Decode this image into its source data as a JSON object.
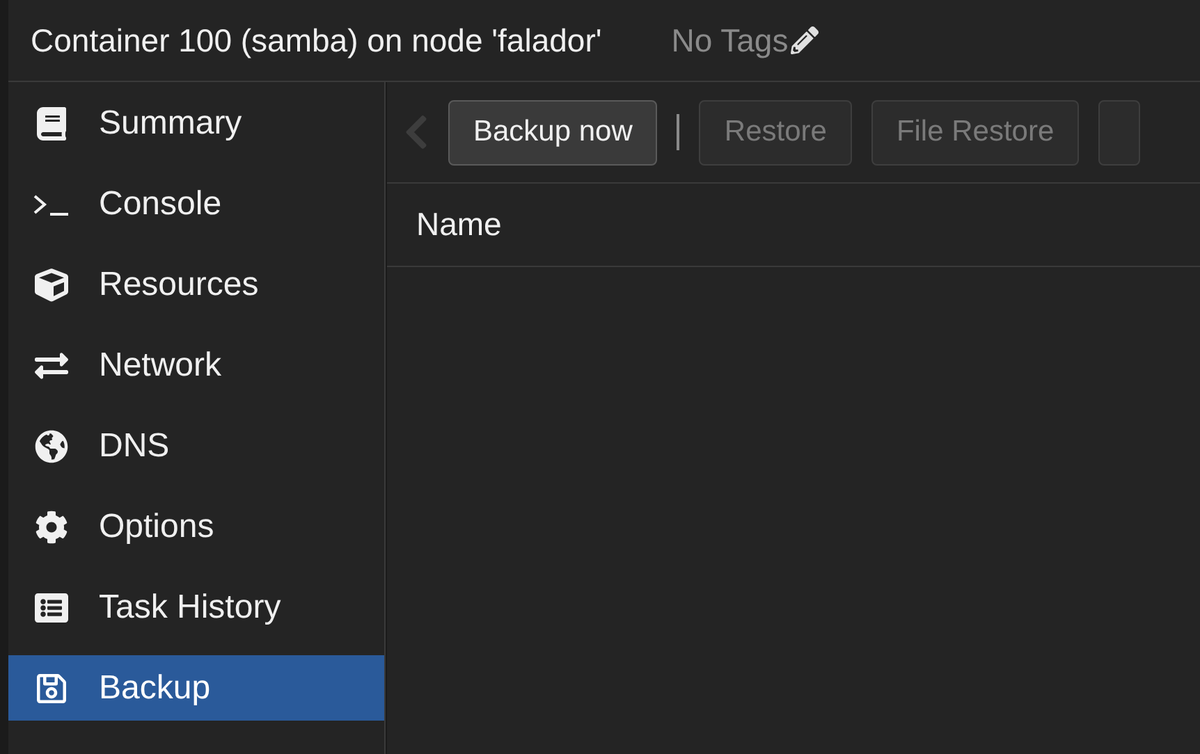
{
  "header": {
    "title": "Container 100 (samba) on node 'falador'",
    "tags": "No Tags"
  },
  "sidebar": {
    "items": [
      {
        "label": "Summary",
        "selected": false
      },
      {
        "label": "Console",
        "selected": false
      },
      {
        "label": "Resources",
        "selected": false
      },
      {
        "label": "Network",
        "selected": false
      },
      {
        "label": "DNS",
        "selected": false
      },
      {
        "label": "Options",
        "selected": false
      },
      {
        "label": "Task History",
        "selected": false
      },
      {
        "label": "Backup",
        "selected": true
      }
    ]
  },
  "toolbar": {
    "buttons": [
      {
        "label": "Backup now",
        "disabled": false
      },
      {
        "label": "Restore",
        "disabled": true
      },
      {
        "label": "File Restore",
        "disabled": true
      }
    ]
  },
  "table": {
    "columns": [
      "Name"
    ]
  }
}
